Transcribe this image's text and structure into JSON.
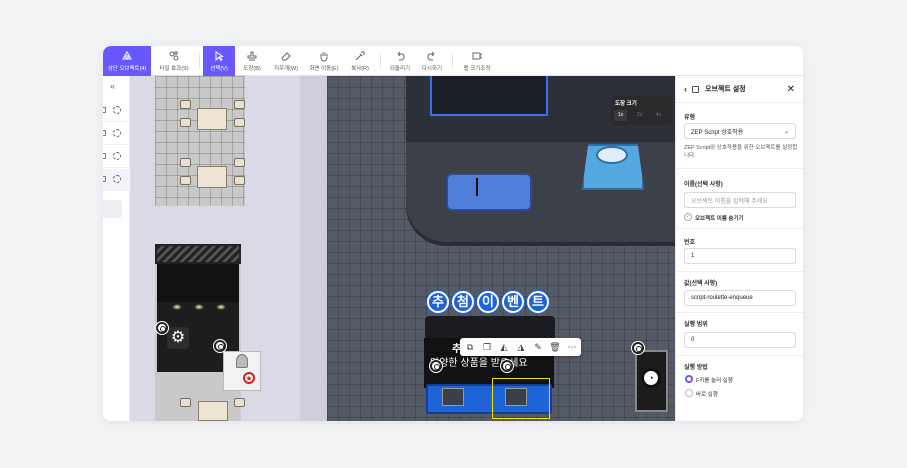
{
  "toolbar": {
    "items": [
      {
        "label": "상단 오브젝트(4)",
        "icon": "top-object-icon"
      },
      {
        "label": "타일 효과(S)",
        "icon": "tile-effect-icon"
      },
      {
        "label": "선택(V)",
        "icon": "select-cursor-icon"
      },
      {
        "label": "도장(B)",
        "icon": "stamp-icon"
      },
      {
        "label": "지우개(W)",
        "icon": "eraser-icon"
      },
      {
        "label": "화면 이동(E)",
        "icon": "hand-icon"
      },
      {
        "label": "복사(R)",
        "icon": "eyedropper-icon"
      },
      {
        "label": "되돌리기",
        "icon": "undo-icon"
      },
      {
        "label": "다시하기",
        "icon": "redo-icon"
      },
      {
        "label": "맵 크기조정",
        "icon": "resize-map-icon"
      }
    ]
  },
  "canvas": {
    "stamp_size_title": "도장 크기",
    "stamp_sizes": [
      "1x",
      "2x",
      "4x"
    ],
    "banner_chars": [
      "추",
      "첨",
      "이",
      "벤",
      "트"
    ],
    "booth_line1": "추",
    "booth_line2": "다양한 상품을 받으세요"
  },
  "panel": {
    "title": "오브젝트 설정",
    "type_label": "유형",
    "type_value": "ZEP Script 상호작용",
    "type_desc": "ZEP Script와 상호작용을 위한 오브젝트를 설정합니다.",
    "name_label": "이름(선택 사항)",
    "name_placeholder": "오브젝트 이름을 입력해 주세요",
    "hide_name_label": "오브젝트 이름 숨기기",
    "number_label": "번호",
    "number_value": "1",
    "value_label": "값(선택 사항)",
    "value_value": "script-roulette-enqueue",
    "range_label": "실행 범위",
    "range_value": "0",
    "method_label": "실행 방법",
    "method_options": [
      "F키를 눌러 실행",
      "바로 실행"
    ],
    "method_selected": "F키를 눌러 실행"
  },
  "colors": {
    "accent": "#6758ff",
    "booth_blue": "#1e63d8"
  }
}
